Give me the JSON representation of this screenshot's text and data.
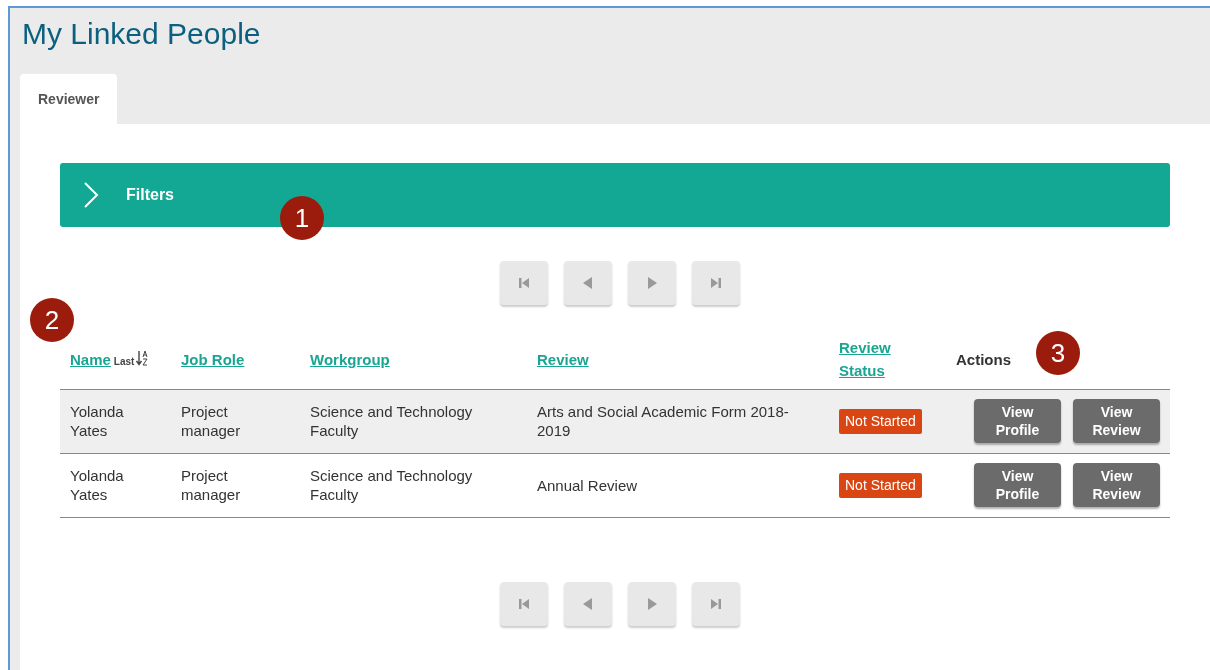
{
  "page": {
    "title": "My Linked People"
  },
  "tabs": [
    {
      "label": "Reviewer",
      "selected": true
    }
  ],
  "filters": {
    "label": "Filters",
    "expanded": false
  },
  "table": {
    "columns": [
      {
        "label": "Name",
        "kind": "link",
        "sort_hint": "Last"
      },
      {
        "label": "Job Role",
        "kind": "link"
      },
      {
        "label": "Workgroup",
        "kind": "link"
      },
      {
        "label": "Review",
        "kind": "link"
      },
      {
        "label": "Review Status",
        "kind": "link"
      },
      {
        "label": "Actions",
        "kind": "plain"
      }
    ],
    "rows": [
      {
        "selected": true,
        "name": "Yolanda Yates",
        "job_role": "Project manager",
        "workgroup": "Science and Technology Faculty",
        "review": "Arts and Social Academic Form 2018-2019",
        "status": "Not Started",
        "actions": [
          "View Profile",
          "View Review"
        ]
      },
      {
        "selected": false,
        "name": "Yolanda Yates",
        "job_role": "Project manager",
        "workgroup": "Science and Technology Faculty",
        "review": "Annual Review",
        "status": "Not Started",
        "actions": [
          "View Profile",
          "View Review"
        ]
      }
    ]
  },
  "callouts": [
    "1",
    "2",
    "3"
  ]
}
